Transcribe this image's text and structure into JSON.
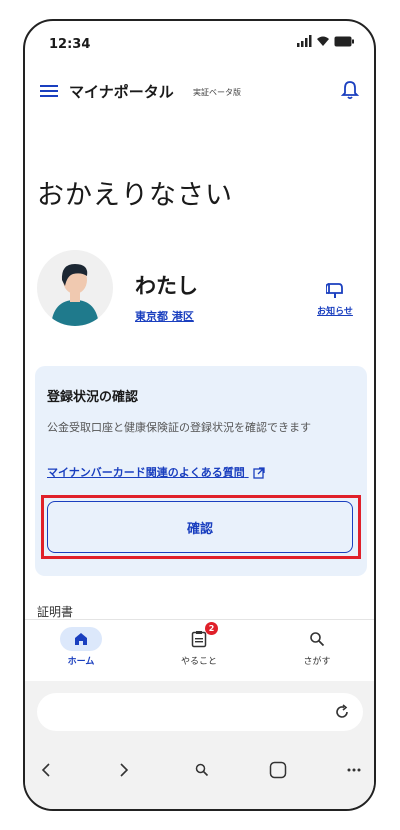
{
  "status": {
    "time": "12:34"
  },
  "app": {
    "title": "マイナポータル",
    "subtitle": "実証ベータ版"
  },
  "welcome": "おかえりなさい",
  "profile": {
    "name": "わたし",
    "location": "東京都 港区",
    "notice_label": "お知らせ"
  },
  "card": {
    "title": "登録状況の確認",
    "description": "公金受取口座と健康保険証の登録状況を確認できます",
    "link": "マイナンバーカード関連のよくある質問",
    "button": "確認"
  },
  "section": {
    "label": "証明書"
  },
  "nav": {
    "items": [
      {
        "label": "ホーム",
        "icon": "home-icon"
      },
      {
        "label": "やること",
        "icon": "clipboard-icon",
        "badge": "2"
      },
      {
        "label": "さがす",
        "icon": "search-icon"
      }
    ]
  },
  "colors": {
    "accent": "#1a3fbf",
    "highlight": "#e0202a",
    "card_bg": "#e9f1fb"
  }
}
